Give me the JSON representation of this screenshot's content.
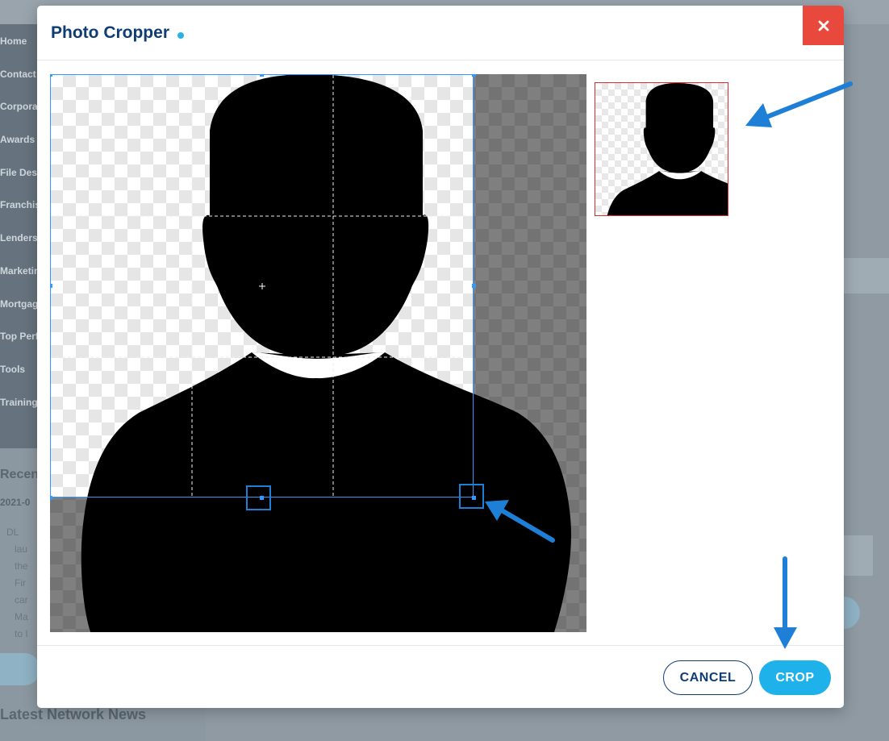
{
  "background": {
    "nav_items": [
      "Home",
      "Contact",
      "Corpora",
      "Awards",
      "File Desk",
      "Franchis",
      "Lenders",
      "Marketin",
      "Mortgag",
      "Top Perf",
      "Tools",
      "Training"
    ],
    "recent_title": "Recen",
    "recent_date": "2021-0",
    "bullet_text": "DL\n   lau\n   the\n   Fir\n   car\n   Ma\n   to I",
    "news_title": "Latest Network News"
  },
  "modal": {
    "title": "Photo Cropper",
    "close_label": "×"
  },
  "footer": {
    "cancel_label": "CANCEL",
    "crop_label": "CROP"
  },
  "colors": {
    "title": "#0e3d74",
    "accent": "#1fb1ea",
    "close": "#e8493c",
    "crop_guide": "#3399ff",
    "preview_border": "#d32f2f",
    "annotation_arrow": "#1e7fd6"
  },
  "icons": {
    "close": "close-icon",
    "silhouette": "person-silhouette-icon",
    "arrow": "annotation-arrow-icon"
  }
}
